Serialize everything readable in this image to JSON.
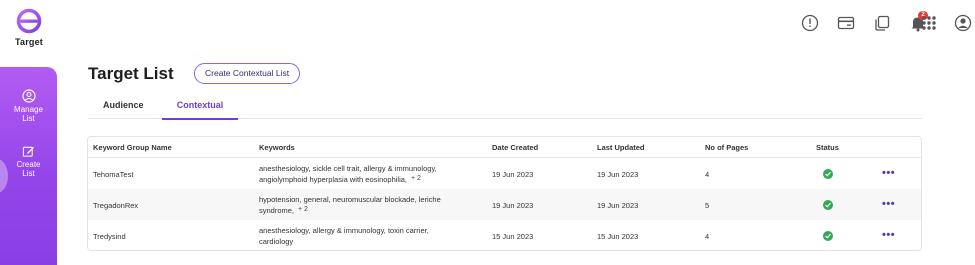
{
  "app": {
    "logo_text": "Target"
  },
  "sidebar": {
    "items": [
      {
        "label_line1": "Manage",
        "label_line2": "List",
        "icon": "user-circle-icon"
      },
      {
        "label_line1": "Create",
        "label_line2": "List",
        "icon": "edit-icon"
      }
    ]
  },
  "topbar": {
    "icons": [
      "alert-circle-icon",
      "card-icon",
      "copy-icon",
      "bell-icon",
      "apps-grid-icon",
      "profile-icon"
    ],
    "notification_count": "2"
  },
  "page": {
    "title": "Target List",
    "create_button": "Create Contextual List"
  },
  "tabs": [
    {
      "label": "Audience",
      "active": false
    },
    {
      "label": "Contextual",
      "active": true
    }
  ],
  "table": {
    "headers": [
      "Keyword Group Name",
      "Keywords",
      "Date Created",
      "Last Updated",
      "No of Pages",
      "Status"
    ],
    "rows": [
      {
        "name": "TehomaTest",
        "keywords_line1": "anesthesiology, sickle cell trait, allergy & immunology,",
        "keywords_line2": "angiolymphoid hyperplasia with eosinophilia,",
        "more": "+ 2",
        "date_created": "19 Jun 2023",
        "last_updated": "19 Jun 2023",
        "pages": "4",
        "status": "active"
      },
      {
        "name": "TregadonRex",
        "keywords_line1": "hypotension, general, neuromuscular blockade, leriche",
        "keywords_line2": "syndrome,",
        "more": "+ 2",
        "date_created": "19 Jun 2023",
        "last_updated": "19 Jun 2023",
        "pages": "5",
        "status": "active"
      },
      {
        "name": "Tredysind",
        "keywords_line1": "anesthesiology, allergy & immunology, toxin carrier,",
        "keywords_line2": "cardiology",
        "more": "",
        "date_created": "15 Jun 2023",
        "last_updated": "15 Jun 2023",
        "pages": "4",
        "status": "active"
      }
    ],
    "actions_label": "•••"
  },
  "colors": {
    "accent": "#6c3fd8",
    "sidebar_top": "#b25cf2",
    "sidebar_bottom": "#8a3fe6",
    "status_ok": "#34a853",
    "badge": "#e53935"
  }
}
